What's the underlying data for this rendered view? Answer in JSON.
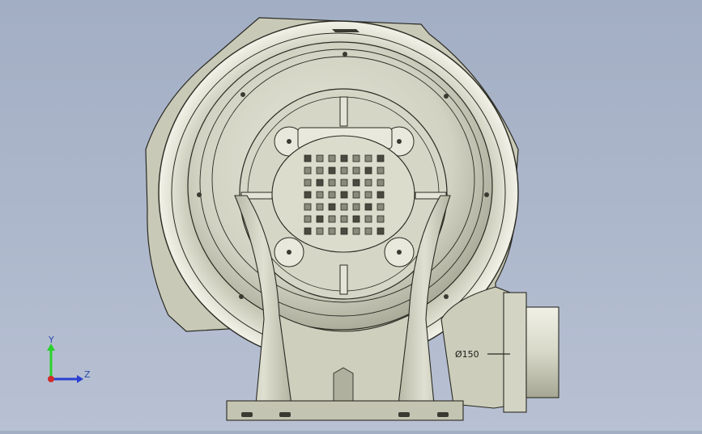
{
  "viewport": {
    "background_top": "#a2aec4",
    "background_bottom": "#b8c1d3",
    "model_color": "#d4d4c4",
    "edge_color": "#2a2a22"
  },
  "model": {
    "outlet_dimension_label": "Ø150"
  },
  "triad": {
    "y_label": "Y",
    "z_label": "Z",
    "y_color": "#2bd12b",
    "z_color": "#2b3fd1",
    "x_color": "#d12b2b"
  }
}
